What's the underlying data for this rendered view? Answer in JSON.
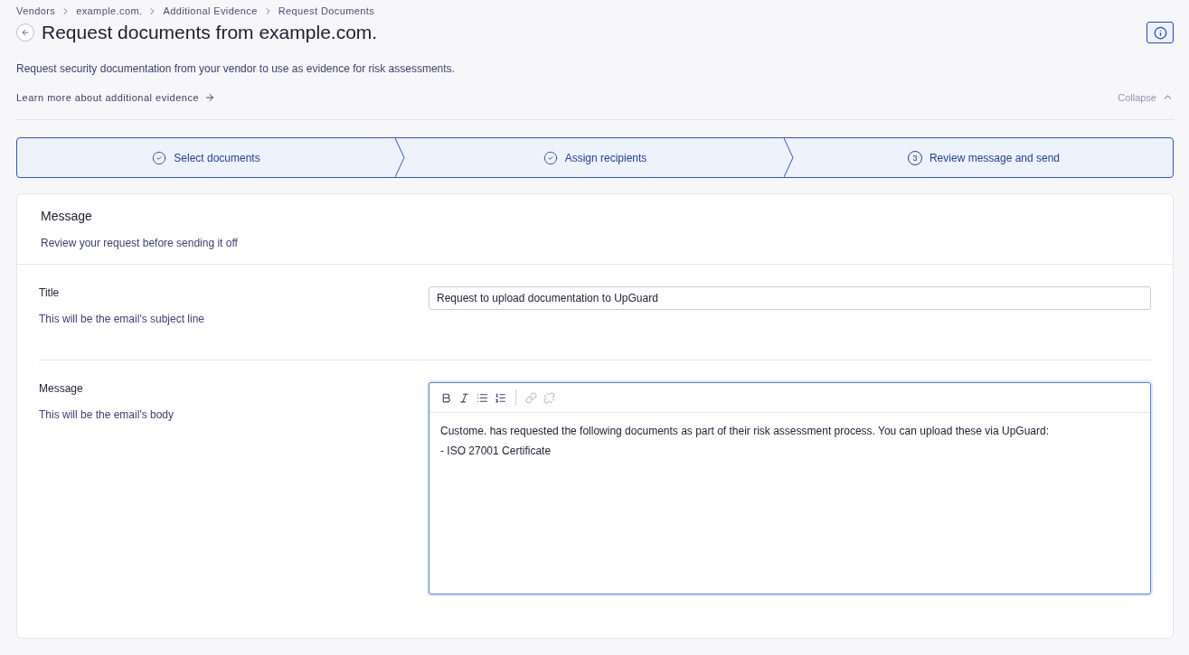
{
  "breadcrumbs": [
    "Vendors",
    "example.com.",
    "Additional Evidence",
    "Request Documents"
  ],
  "title": "Request documents from example.com.",
  "description": "Request security documentation from your vendor to use as evidence for risk assessments.",
  "learn_more": "Learn more about additional evidence",
  "collapse": "Collapse",
  "steps": [
    {
      "label": "Select documents",
      "completed": true
    },
    {
      "label": "Assign recipients",
      "completed": true
    },
    {
      "label": "Review message and send",
      "completed": false,
      "number": "3"
    }
  ],
  "card": {
    "title": "Message",
    "subtitle": "Review your request before sending it off"
  },
  "fields": [
    {
      "kind": "input",
      "label": "Title",
      "hint": "This will be the email's subject line",
      "value": "Request to upload documentation to UpGuard"
    },
    {
      "kind": "editor",
      "label": "Message",
      "hint": "This will be the email's body",
      "toolbar": [
        {
          "kind": "bold",
          "disabled": false
        },
        {
          "kind": "italic",
          "disabled": false
        },
        {
          "kind": "bullets",
          "disabled": false
        },
        {
          "kind": "numbers",
          "disabled": false
        },
        {
          "kind": "link",
          "disabled": true
        },
        {
          "kind": "unlink",
          "disabled": true
        }
      ],
      "lines": [
        "Custome. has requested the following documents as part of their risk assessment process. You can upload these via UpGuard:",
        "- ISO 27001 Certificate"
      ]
    }
  ]
}
